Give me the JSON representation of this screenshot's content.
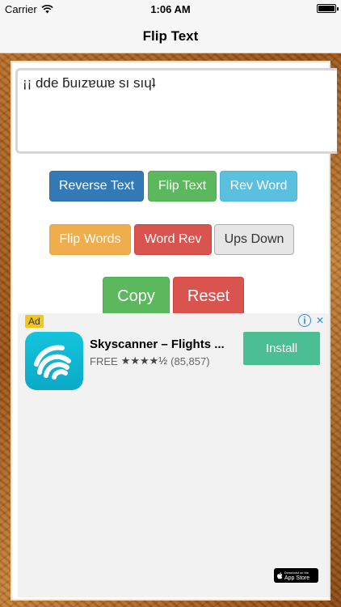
{
  "status_bar": {
    "carrier": "Carrier",
    "time": "1:06 AM"
  },
  "nav": {
    "title": "Flip Text"
  },
  "text_area": {
    "value": "¡¡ dde ƃuızɐɯɐ sı sıɥʇ"
  },
  "buttons": {
    "reverse_text": "Reverse Text",
    "flip_text": "Flip Text",
    "rev_word": "Rev Word",
    "flip_words": "Flip Words",
    "word_rev": "Word Rev",
    "ups_down": "Ups Down",
    "copy": "Copy",
    "reset": "Reset"
  },
  "ad": {
    "badge": "Ad",
    "app_name": "Skyscanner – Flights ...",
    "price": "FREE",
    "stars": "★★★★½",
    "rating_value": 4.5,
    "rating_count": "(85,857)",
    "install_label": "Install",
    "store_badge_small": "Download on the",
    "store_badge_big": "App Store",
    "icons": [
      "info-icon",
      "close-icon",
      "skyscanner-logo",
      "apple-icon"
    ]
  },
  "colors": {
    "primary": "#337ab7",
    "success": "#5cb85c",
    "info": "#5bc0de",
    "warning": "#f0ad4e",
    "danger": "#d9534f",
    "install": "#4bbf93"
  }
}
